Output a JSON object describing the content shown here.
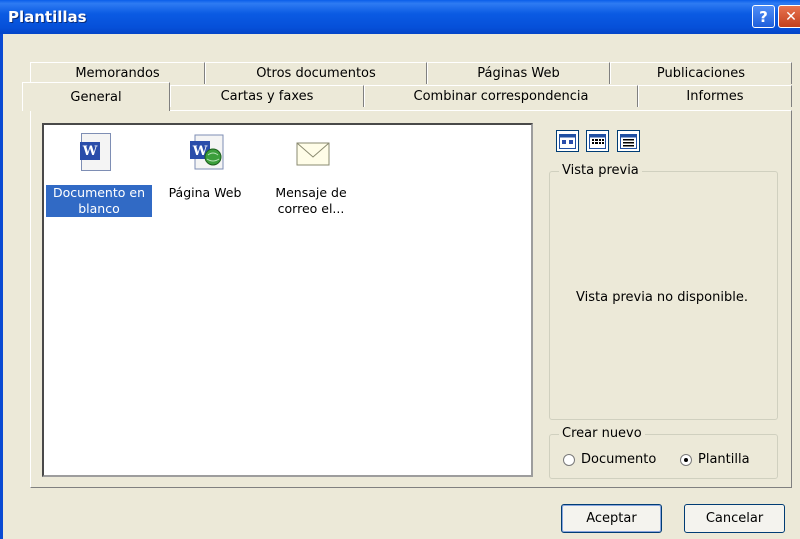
{
  "window": {
    "title": "Plantillas",
    "help_glyph": "?",
    "close_glyph": "✕"
  },
  "tabs": {
    "back_row": [
      {
        "label": "Memorandos"
      },
      {
        "label": "Otros documentos"
      },
      {
        "label": "Páginas Web"
      },
      {
        "label": "Publicaciones"
      }
    ],
    "front_row": [
      {
        "label": "General",
        "active": true
      },
      {
        "label": "Cartas y faxes"
      },
      {
        "label": "Combinar correspondencia"
      },
      {
        "label": "Informes"
      }
    ]
  },
  "templates": [
    {
      "label": "Documento en blanco",
      "icon": "blank-document-icon",
      "selected": true
    },
    {
      "label": "Página Web",
      "icon": "web-page-icon",
      "selected": false
    },
    {
      "label": "Mensaje de correo el...",
      "icon": "email-message-icon",
      "selected": false
    }
  ],
  "view_buttons": [
    {
      "icon": "large-icons-view-icon"
    },
    {
      "icon": "list-view-icon"
    },
    {
      "icon": "details-view-icon"
    }
  ],
  "preview": {
    "group_label": "Vista previa",
    "message": "Vista previa no disponible."
  },
  "create_new": {
    "group_label": "Crear nuevo",
    "options": [
      {
        "label": "Documento",
        "checked": false
      },
      {
        "label": "Plantilla",
        "checked": true
      }
    ]
  },
  "buttons": {
    "ok": "Aceptar",
    "cancel": "Cancelar"
  },
  "colors": {
    "titlebar": "#0650D9",
    "selection": "#316AC5",
    "face": "#ECE9D8"
  }
}
